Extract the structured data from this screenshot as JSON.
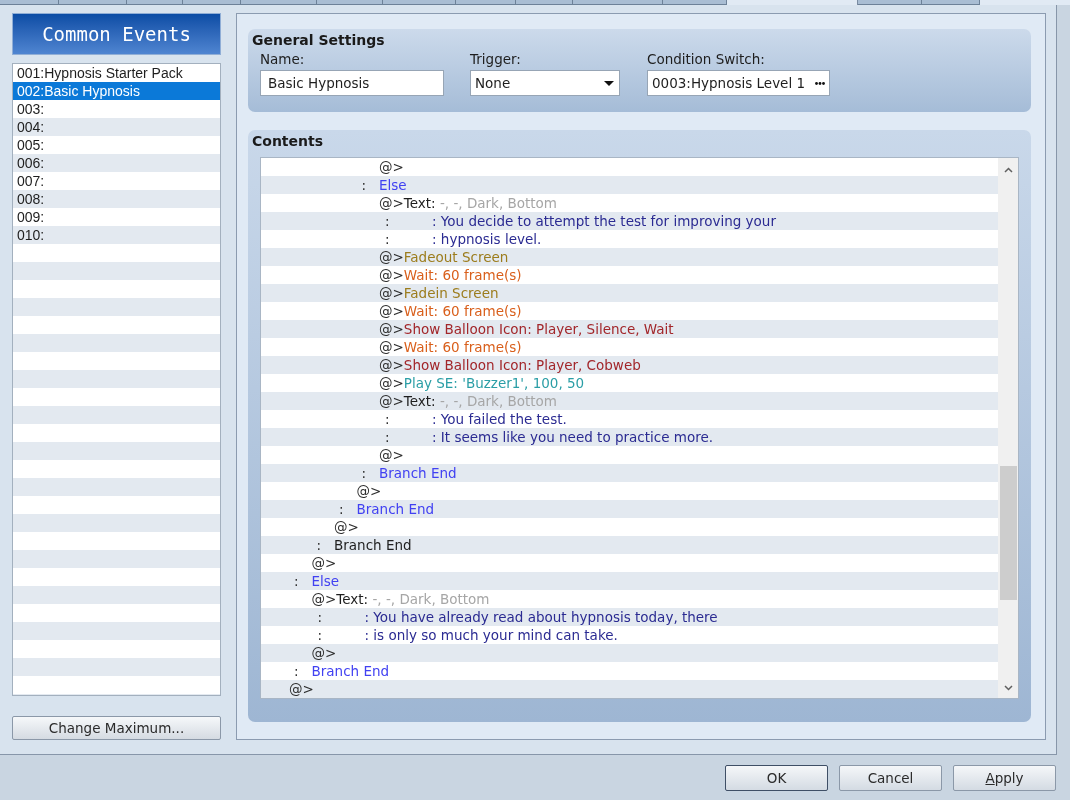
{
  "tabs": [
    {
      "selected": false
    },
    {
      "selected": false
    },
    {
      "selected": false
    },
    {
      "selected": false
    },
    {
      "selected": false
    },
    {
      "selected": false
    },
    {
      "selected": false
    },
    {
      "selected": false
    },
    {
      "selected": false
    },
    {
      "selected": false
    },
    {
      "selected": false
    },
    {
      "selected": true
    },
    {
      "selected": false
    },
    {
      "selected": false
    }
  ],
  "common_events": {
    "title": "Common Events",
    "items": [
      {
        "label": "001:Hypnosis Starter Pack",
        "selected": false
      },
      {
        "label": "002:Basic Hypnosis",
        "selected": true
      },
      {
        "label": "003:",
        "selected": false
      },
      {
        "label": "004:",
        "selected": false
      },
      {
        "label": "005:",
        "selected": false
      },
      {
        "label": "006:",
        "selected": false
      },
      {
        "label": "007:",
        "selected": false
      },
      {
        "label": "008:",
        "selected": false
      },
      {
        "label": "009:",
        "selected": false
      },
      {
        "label": "010:",
        "selected": false
      }
    ],
    "button": "Change Maximum..."
  },
  "general_settings": {
    "title": "General Settings",
    "name": {
      "label": "Name:",
      "value": "Basic Hypnosis"
    },
    "trigger": {
      "label": "Trigger:",
      "value": "None"
    },
    "condition_switch": {
      "label": "Condition Switch:",
      "value": "0003:Hypnosis Level 1"
    }
  },
  "contents": {
    "title": "Contents",
    "lines": [
      {
        "kind": "group",
        "children": [
          {
            "kind": "group",
            "children": [
              {
                "kind": "group",
                "children": [
                  {
                    "kind": "group",
                    "children": [
                      {
                        "kind": "command",
                        "marker": "@>"
                      }
                    ]
                  },
                  {
                    "kind": "branch",
                    "marker": ":",
                    "text": "Else",
                    "color": "#4141f2",
                    "children": [
                      {
                        "kind": "command",
                        "marker": "@>",
                        "text": "Text:",
                        "color": "#1e1e1e",
                        "params": "-, -, Dark, Bottom"
                      },
                      {
                        "kind": "message",
                        "marker": ":",
                        "text": ": You decide to attempt the test for improving your",
                        "color": "#2b2b92"
                      },
                      {
                        "kind": "message",
                        "marker": ":",
                        "text": ": hypnosis level.",
                        "color": "#2b2b92"
                      },
                      {
                        "kind": "command",
                        "marker": "@>",
                        "text": "Fadeout Screen",
                        "color": "#9c7c1c"
                      },
                      {
                        "kind": "command",
                        "marker": "@>",
                        "text": "Wait: 60 frame(s)",
                        "color": "#d95f1b"
                      },
                      {
                        "kind": "command",
                        "marker": "@>",
                        "text": "Fadein Screen",
                        "color": "#9c7c1c"
                      },
                      {
                        "kind": "command",
                        "marker": "@>",
                        "text": "Wait: 60 frame(s)",
                        "color": "#d95f1b"
                      },
                      {
                        "kind": "command",
                        "marker": "@>",
                        "text": "Show Balloon Icon: Player, Silence, Wait",
                        "color": "#a2262a"
                      },
                      {
                        "kind": "command",
                        "marker": "@>",
                        "text": "Wait: 60 frame(s)",
                        "color": "#d95f1b"
                      },
                      {
                        "kind": "command",
                        "marker": "@>",
                        "text": "Show Balloon Icon: Player, Cobweb",
                        "color": "#a2262a"
                      },
                      {
                        "kind": "command",
                        "marker": "@>",
                        "text": "Play SE: 'Buzzer1', 100, 50",
                        "color": "#2a9ea6"
                      },
                      {
                        "kind": "command",
                        "marker": "@>",
                        "text": "Text:",
                        "color": "#1e1e1e",
                        "params": "-, -, Dark, Bottom"
                      },
                      {
                        "kind": "message",
                        "marker": ":",
                        "text": ": You failed the test.",
                        "color": "#2b2b92"
                      },
                      {
                        "kind": "message",
                        "marker": ":",
                        "text": ": It seems like you need to practice more.",
                        "color": "#2b2b92"
                      },
                      {
                        "kind": "command",
                        "marker": "@>"
                      }
                    ]
                  },
                  {
                    "kind": "branch",
                    "marker": ":",
                    "text": "Branch End",
                    "color": "#4141f2"
                  },
                  {
                    "kind": "command",
                    "marker": "@>"
                  }
                ]
              },
              {
                "kind": "branch",
                "marker": ":",
                "text": "Branch End",
                "color": "#4141f2"
              },
              {
                "kind": "command",
                "marker": "@>"
              }
            ]
          },
          {
            "kind": "branch",
            "marker": ":",
            "text": "Branch End",
            "color": "#1e1e1e"
          },
          {
            "kind": "command",
            "marker": "@>"
          }
        ]
      },
      {
        "kind": "branch",
        "marker": ":",
        "text": "Else",
        "color": "#4141f2",
        "children": [
          {
            "kind": "command",
            "marker": "@>",
            "text": "Text:",
            "color": "#1e1e1e",
            "params": "-, -, Dark, Bottom"
          },
          {
            "kind": "message",
            "marker": ":",
            "text": ": You have already read about hypnosis today, there",
            "color": "#2b2b92"
          },
          {
            "kind": "message",
            "marker": ":",
            "text": ": is only so much your mind can take.",
            "color": "#2b2b92"
          },
          {
            "kind": "command",
            "marker": "@>"
          }
        ]
      },
      {
        "kind": "branch",
        "marker": ":",
        "text": "Branch End",
        "color": "#4141f2"
      },
      {
        "kind": "command",
        "marker": "@>"
      }
    ]
  },
  "buttons": [
    {
      "label": "OK",
      "default": true,
      "underlined_initial": false
    },
    {
      "label": "Cancel",
      "default": false,
      "underlined_initial": false
    },
    {
      "label": "Apply",
      "default": false,
      "underlined_initial": true
    }
  ]
}
